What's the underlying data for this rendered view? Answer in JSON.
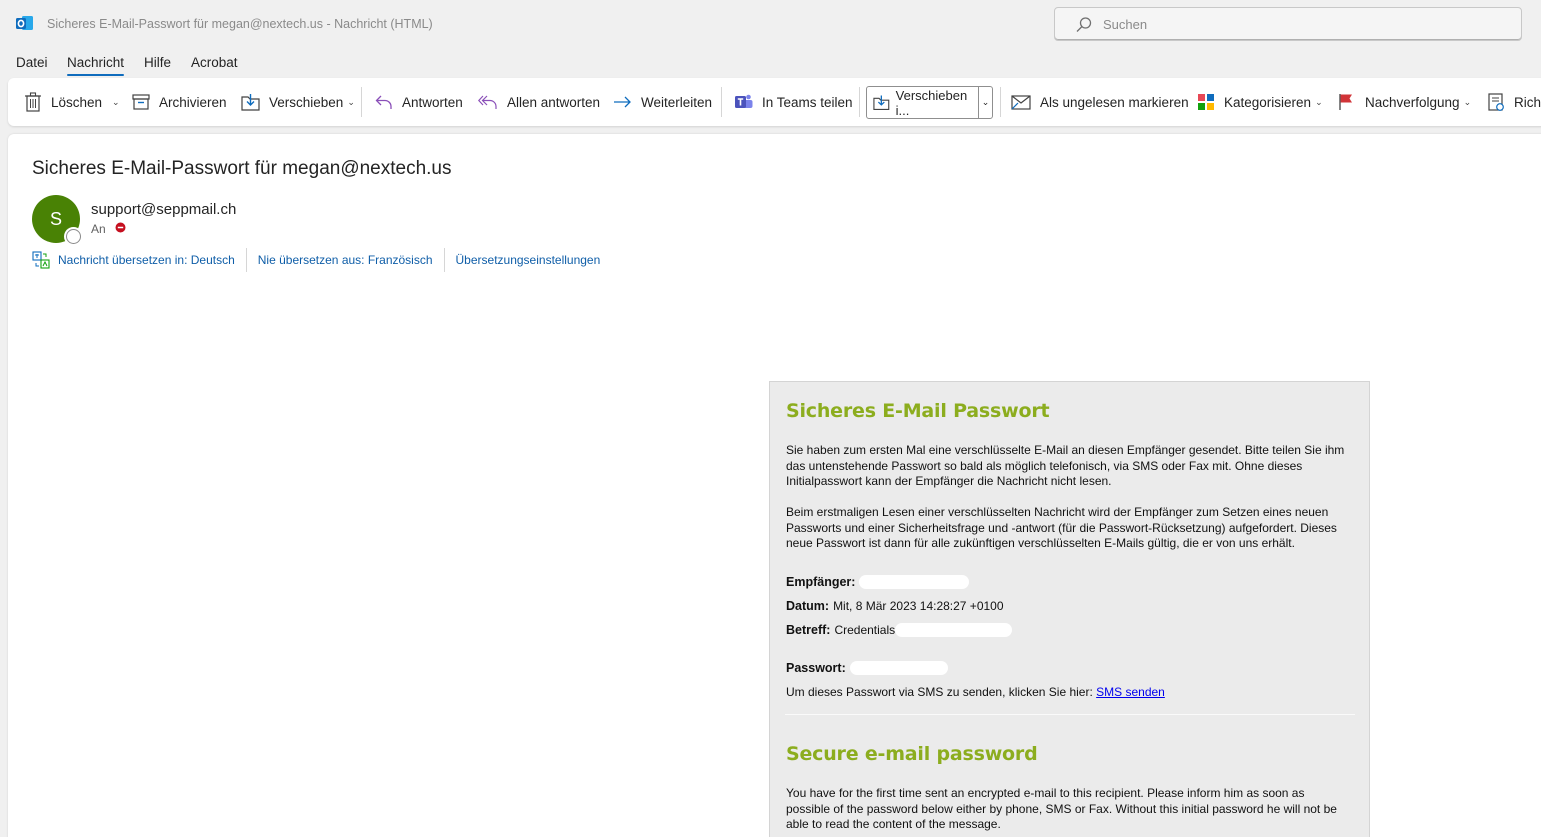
{
  "titlebar": {
    "window_title": "Sicheres E-Mail-Passwort für megan@nextech.us  -  Nachricht (HTML)",
    "search_placeholder": "Suchen"
  },
  "menu": {
    "tabs": [
      {
        "label": "Datei"
      },
      {
        "label": "Nachricht",
        "active": true
      },
      {
        "label": "Hilfe"
      },
      {
        "label": "Acrobat"
      }
    ]
  },
  "ribbon": {
    "delete": "Löschen",
    "archive": "Archivieren",
    "move": "Verschieben",
    "reply": "Antworten",
    "reply_all": "Allen antworten",
    "forward": "Weiterleiten",
    "teams_share": "In Teams teilen",
    "move_to": "Verschieben i...",
    "mark_unread": "Als ungelesen markieren",
    "categorize": "Kategorisieren",
    "followup": "Nachverfolgung",
    "policy": "Richt"
  },
  "message": {
    "subject": "Sicheres E-Mail-Passwort für megan@nextech.us",
    "avatar_initial": "S",
    "sender": "support@seppmail.ch",
    "to_label": "An",
    "translate": {
      "translate_to": "Nachricht übersetzen in: Deutsch",
      "never_translate": "Nie übersetzen aus: Französisch",
      "settings": "Übersetzungseinstellungen"
    }
  },
  "body": {
    "de_title": "Sicheres E-Mail Passwort",
    "de_para1": "Sie haben zum ersten Mal eine verschlüsselte E-Mail an diesen Empfänger gesendet. Bitte teilen Sie ihm das untenstehende Passwort so bald als möglich telefonisch, via SMS oder Fax mit. Ohne dieses Initialpasswort kann der Empfänger die Nachricht nicht lesen.",
    "de_para2": "Beim erstmaligen Lesen einer verschlüsselten Nachricht wird der Empfänger zum Setzen eines neuen Passworts und einer Sicherheitsfrage und -antwort (für die Passwort-Rücksetzung) aufgefordert. Dieses neue Passwort ist dann für alle zukünftigen verschlüsselten E-Mails gültig, die er von uns erhält.",
    "recipient_label": "Empfänger:",
    "date_label": "Datum:",
    "date_value": "Mit, 8 Mär 2023 14:28:27 +0100",
    "subject_label": "Betreff:",
    "subject_value": "Credentials",
    "password_label": "Passwort:",
    "sms_text": "Um dieses Passwort via SMS zu senden, klicken Sie hier:",
    "sms_link": "SMS senden",
    "en_title": "Secure e-mail password",
    "en_para1": "You have for the first time sent an encrypted e-mail to this recipient. Please inform him as soon as possible of the password below either by phone, SMS or Fax. Without this initial password he will not be able to read the content of the message."
  },
  "colors": {
    "accent": "#0f6cbd",
    "avatar": "#498205",
    "heading_green": "#8cad1e",
    "link": "#0f5ea8"
  }
}
